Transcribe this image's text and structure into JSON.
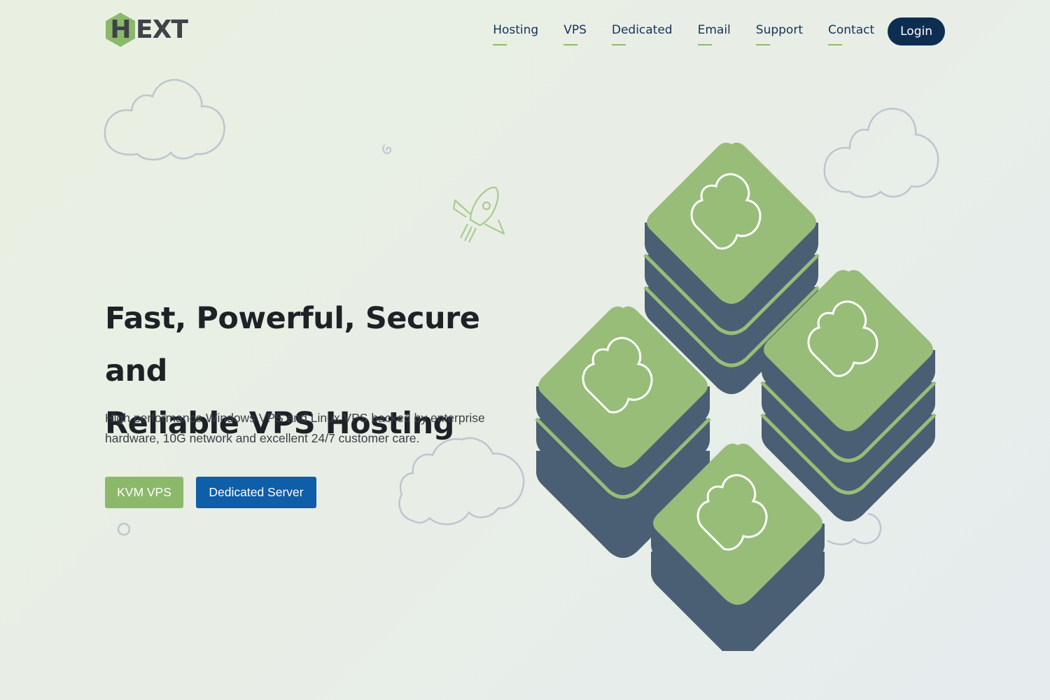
{
  "brand": {
    "logo_text": "EXT",
    "logo_letter": "H",
    "hex_color": "#8cb86a"
  },
  "nav": {
    "items": [
      {
        "label": "Hosting"
      },
      {
        "label": "VPS"
      },
      {
        "label": "Dedicated"
      },
      {
        "label": "Email"
      },
      {
        "label": "Support"
      },
      {
        "label": "Contact"
      }
    ],
    "login_label": "Login",
    "underline_color": "#8dbb6a",
    "login_bg": "#0d2e52"
  },
  "hero": {
    "headline_line1": "Fast, Powerful, Secure and",
    "headline_line2": "Reliable VPS Hosting",
    "description": "High performance Windows VPS and Linux VPS backed by enterprise hardware, 10G network and excellent 24/7 customer care.",
    "primary_button": "KVM VPS",
    "secondary_button": "Dedicated Server"
  },
  "colors": {
    "green": "#8cb86a",
    "blue_button": "#0e5ea8",
    "server_green": "#97bd79",
    "server_side": "#4a5e74",
    "cloud_outline": "#bcc6d0"
  },
  "icons": [
    "cloud-icon",
    "rocket-icon",
    "server-stack-icon"
  ]
}
